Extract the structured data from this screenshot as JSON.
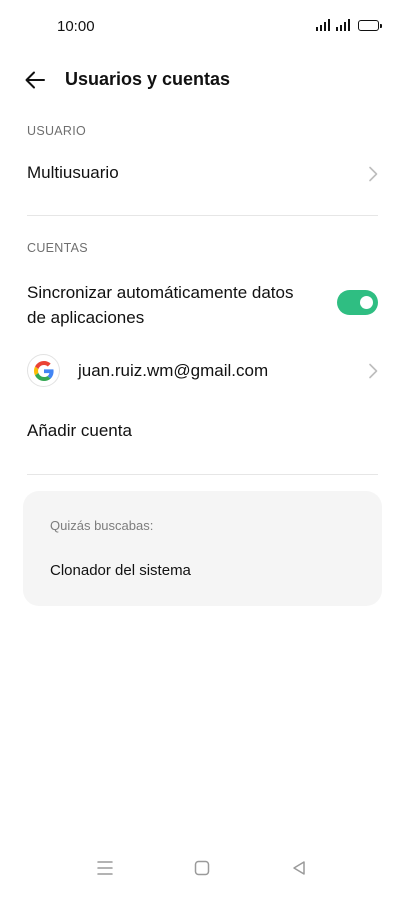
{
  "status_bar": {
    "time": "10:00",
    "icons": [
      "signal-icon",
      "signal-icon",
      "battery-icon"
    ]
  },
  "header": {
    "back_icon": "back-arrow-icon",
    "title": "Usuarios y cuentas"
  },
  "sections": {
    "usuario": {
      "label": "USUARIO",
      "multiuser_label": "Multiusuario"
    },
    "cuentas": {
      "label": "CUENTAS",
      "sync_line1": "Sincronizar automáticamente datos",
      "sync_line2": "de aplicaciones",
      "sync_enabled": true,
      "google_account": "juan.ruiz.wm@gmail.com",
      "add_account": "Añadir cuenta"
    }
  },
  "suggestions": {
    "title": "Quizás buscabas:",
    "item": "Clonador del sistema"
  },
  "colors": {
    "accent": "#2fbe82",
    "card_bg": "#f5f5f5",
    "section_label": "#6f6f6f"
  },
  "nav": {
    "icons": [
      "menu-icon",
      "home-square-icon",
      "back-triangle-icon"
    ]
  }
}
